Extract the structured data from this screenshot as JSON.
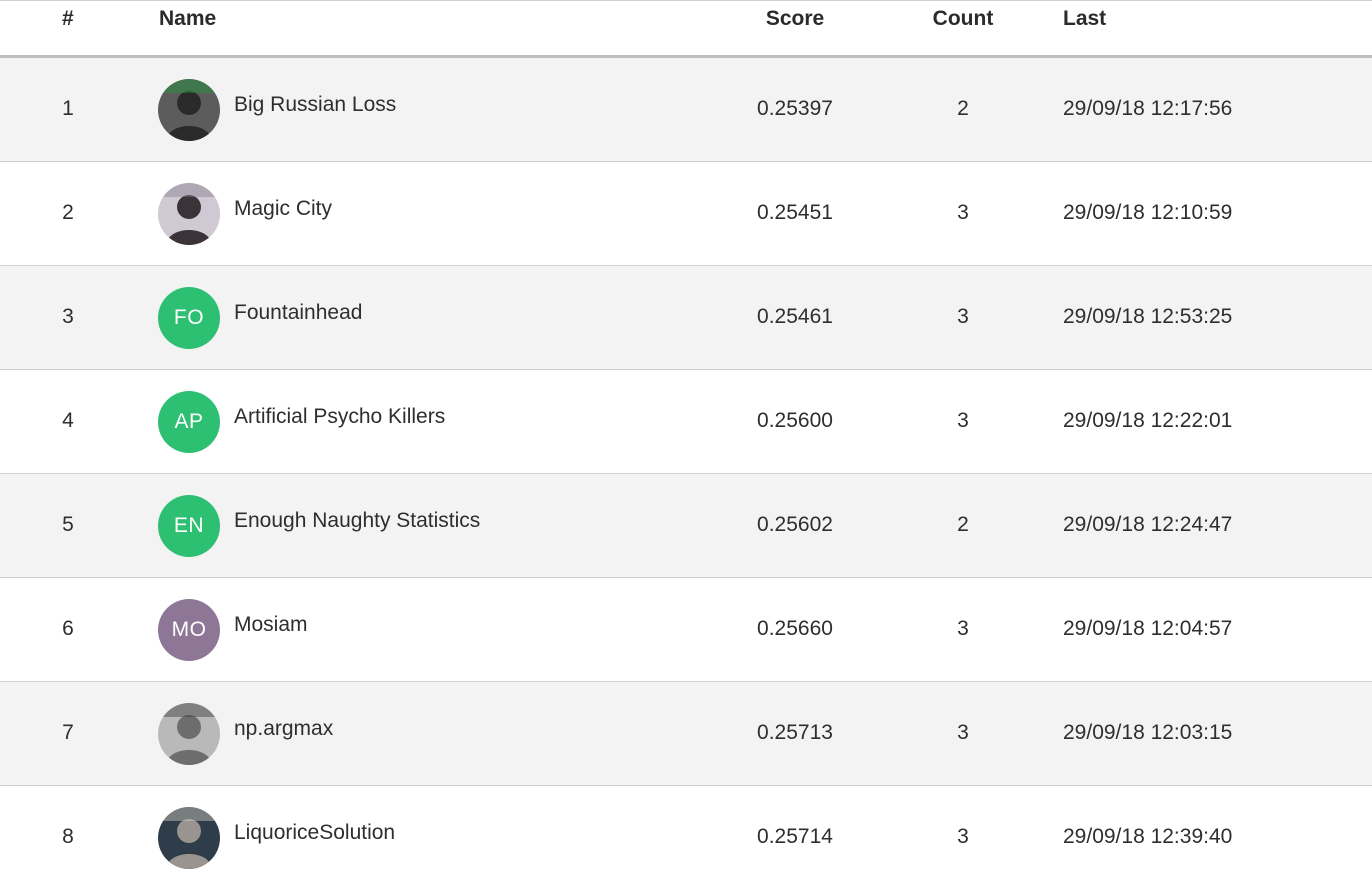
{
  "header": {
    "rank": "#",
    "name": "Name",
    "score": "Score",
    "count": "Count",
    "last": "Last"
  },
  "rows": [
    {
      "rank": "1",
      "name": "Big Russian Loss",
      "score": "0.25397",
      "count": "2",
      "last": "29/09/18 12:17:56",
      "avatar": {
        "type": "photo",
        "icon": "user-photo-icon",
        "colors": [
          "#2a2a2a",
          "#5c5c5c",
          "#1f9a3a"
        ]
      }
    },
    {
      "rank": "2",
      "name": "Magic City",
      "score": "0.25451",
      "count": "3",
      "last": "29/09/18 12:10:59",
      "avatar": {
        "type": "photo",
        "icon": "user-photo-icon",
        "colors": [
          "#3a3438",
          "#cfc9d3",
          "#8a7e8e"
        ]
      }
    },
    {
      "rank": "3",
      "name": "Fountainhead",
      "score": "0.25461",
      "count": "3",
      "last": "29/09/18 12:53:25",
      "avatar": {
        "type": "initials",
        "initials": "FO",
        "color": "#2dbf72"
      }
    },
    {
      "rank": "4",
      "name": "Artificial Psycho Killers",
      "score": "0.25600",
      "count": "3",
      "last": "29/09/18 12:22:01",
      "avatar": {
        "type": "initials",
        "initials": "AP",
        "color": "#2dbf72"
      }
    },
    {
      "rank": "5",
      "name": "Enough Naughty Statistics",
      "score": "0.25602",
      "count": "2",
      "last": "29/09/18 12:24:47",
      "avatar": {
        "type": "initials",
        "initials": "EN",
        "color": "#2dbf72"
      }
    },
    {
      "rank": "6",
      "name": "Mosiam",
      "score": "0.25660",
      "count": "3",
      "last": "29/09/18 12:04:57",
      "avatar": {
        "type": "initials",
        "initials": "MO",
        "color": "#8e7796"
      }
    },
    {
      "rank": "7",
      "name": "np.argmax",
      "score": "0.25713",
      "count": "3",
      "last": "29/09/18 12:03:15",
      "avatar": {
        "type": "photo",
        "icon": "user-photo-icon",
        "colors": [
          "#6d6d6d",
          "#b9b9b9",
          "#3c3c3c"
        ]
      }
    },
    {
      "rank": "8",
      "name": "LiquoriceSolution",
      "score": "0.25714",
      "count": "3",
      "last": "29/09/18 12:39:40",
      "avatar": {
        "type": "photo",
        "icon": "user-photo-icon",
        "colors": [
          "#9a9490",
          "#2f3d4a",
          "#d2cbc4"
        ]
      }
    }
  ]
}
